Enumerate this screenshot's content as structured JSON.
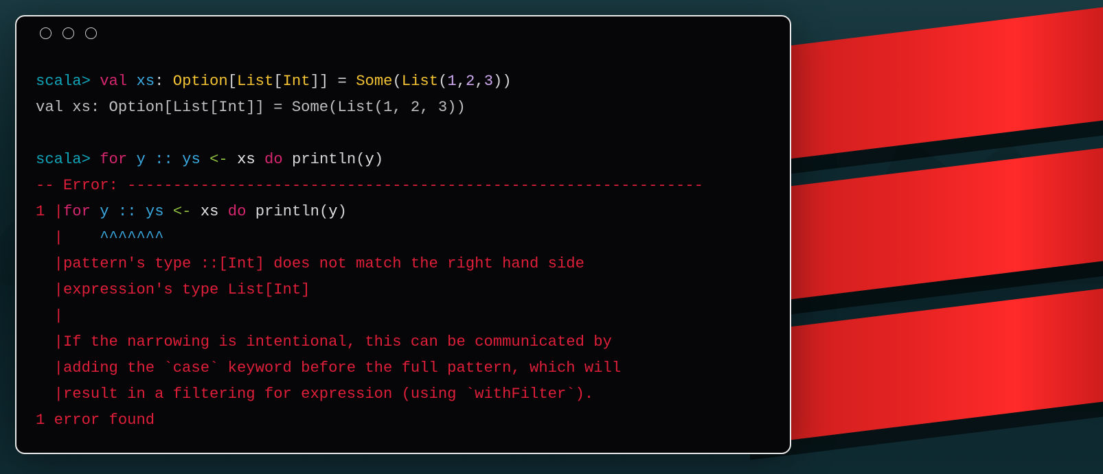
{
  "terminal": {
    "prompt": "scala>",
    "line1": {
      "val": "val",
      "ident": "xs",
      "colon": ":",
      "type_option": "Option",
      "lb1": "[",
      "type_list": "List",
      "lb2": "[",
      "type_int": "Int",
      "rb1": "]",
      "rb2": "]",
      "eq": "=",
      "some": "Some",
      "lp": "(",
      "list": "List",
      "lp2": "(",
      "n1": "1",
      "c1": ",",
      "n2": "2",
      "c2": ",",
      "n3": "3",
      "rp2": ")",
      "rp": ")"
    },
    "line2": {
      "text": "val xs: Option[List[Int]] = Some(List(1, 2, 3))"
    },
    "line3": {
      "for": "for",
      "y": "y",
      "cons": "::",
      "ys": "ys",
      "arrow": "<-",
      "xs": "xs",
      "do": "do",
      "println": "println",
      "lp": "(",
      "arg": "y",
      "rp": ")"
    },
    "error": {
      "header_prefix": "-- Error: ",
      "header_dashes": "---------------------------------------------------------------",
      "lineno": "1",
      "bar": "|",
      "code": {
        "for": "for",
        "y": "y",
        "cons": "::",
        "ys": "ys",
        "arrow": "<-",
        "xs": "xs",
        "do": "do",
        "println": "println",
        "lp": "(",
        "arg": "y",
        "rp": ")"
      },
      "caret_indent": "    ",
      "caret": "^^^^^^^",
      "msg1": "pattern's type ::[Int] does not match the right hand side",
      "msg2": "expression's type List[Int]",
      "msg3": "If the narrowing is intentional, this can be communicated by",
      "msg4": "adding the `case` keyword before the full pattern, which will",
      "msg5": "result in a filtering for expression (using `withFilter`).",
      "footer": "1 error found"
    }
  }
}
